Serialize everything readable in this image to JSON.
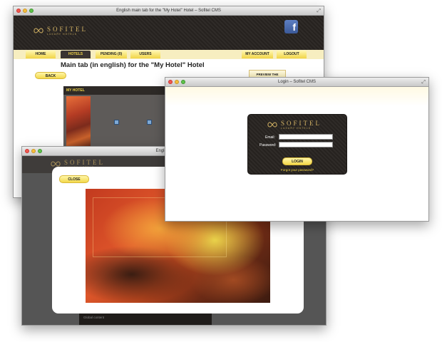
{
  "cms_window": {
    "title": "English main tab for the \"My Hotel\" Hotel – Sofitel CMS",
    "brand_name": "SOFITEL",
    "brand_tagline": "LUXURY HOTELS",
    "social_icon": "f",
    "tabs": [
      "HOME",
      "HOTELS",
      "PENDING (0)",
      "USERS"
    ],
    "right_tabs": [
      "MY ACCOUNT",
      "LOGOUT"
    ],
    "heading": "Main tab (in english) for the \"My Hotel\" Hotel",
    "back_label": "BACK",
    "preview_label": "PREVIEW THE CARROUSEL",
    "panel_title": "MY HOTEL"
  },
  "login_window": {
    "title": "Login – Sofitel CMS",
    "brand_name": "SOFITEL",
    "brand_tagline": "LUXURY HOTELS",
    "email_label": "Email:",
    "password_label": "Password:",
    "login_label": "LOGIN",
    "forgot_label": "Forgot your password?"
  },
  "lightbox_window": {
    "title": "English main tab fo",
    "brand_name": "SOFITEL",
    "brand_tagline": "LUXURY HOTELS",
    "close_label": "CLOSE",
    "footer_text": "Global content"
  },
  "colors": {
    "brand_dark": "#2e2a27",
    "brand_gold": "#d6b565",
    "button_yellow": "#f3d84a"
  }
}
